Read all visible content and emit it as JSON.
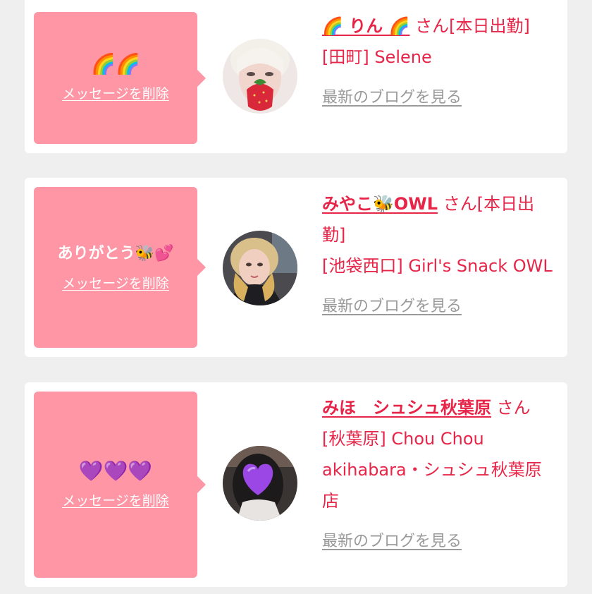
{
  "cards": [
    {
      "message": "🌈🌈",
      "delete_label": "メッセージを削除",
      "name": "🌈 りん 🌈",
      "san": "さん[本日出勤]",
      "shop": "[田町] Selene",
      "blog_label": "最新のブログを見る",
      "avatar_icon": "strawberry-face-photo"
    },
    {
      "message": "ありがとう🐝💕",
      "delete_label": "メッセージを削除",
      "name": "みやこ🐝OWL",
      "san": "さん[本日出勤]",
      "shop": "[池袋西口] Girl's Snack OWL",
      "blog_label": "最新のブログを見る",
      "avatar_icon": "profile-photo"
    },
    {
      "message": "💜💜💜",
      "delete_label": "メッセージを削除",
      "name": "みほ　シュシュ秋葉原",
      "san": "さん",
      "shop": "[秋葉原] Chou Chou akihabara・シュシュ秋葉原店",
      "blog_label": "最新のブログを見る",
      "avatar_icon": "purple-heart-photo"
    }
  ],
  "colors": {
    "page_bg": "#efefef",
    "card_bg": "#ffffff",
    "message_box": "#fe96a5",
    "accent": "#e72548",
    "link_gray": "#9a9a9a"
  }
}
